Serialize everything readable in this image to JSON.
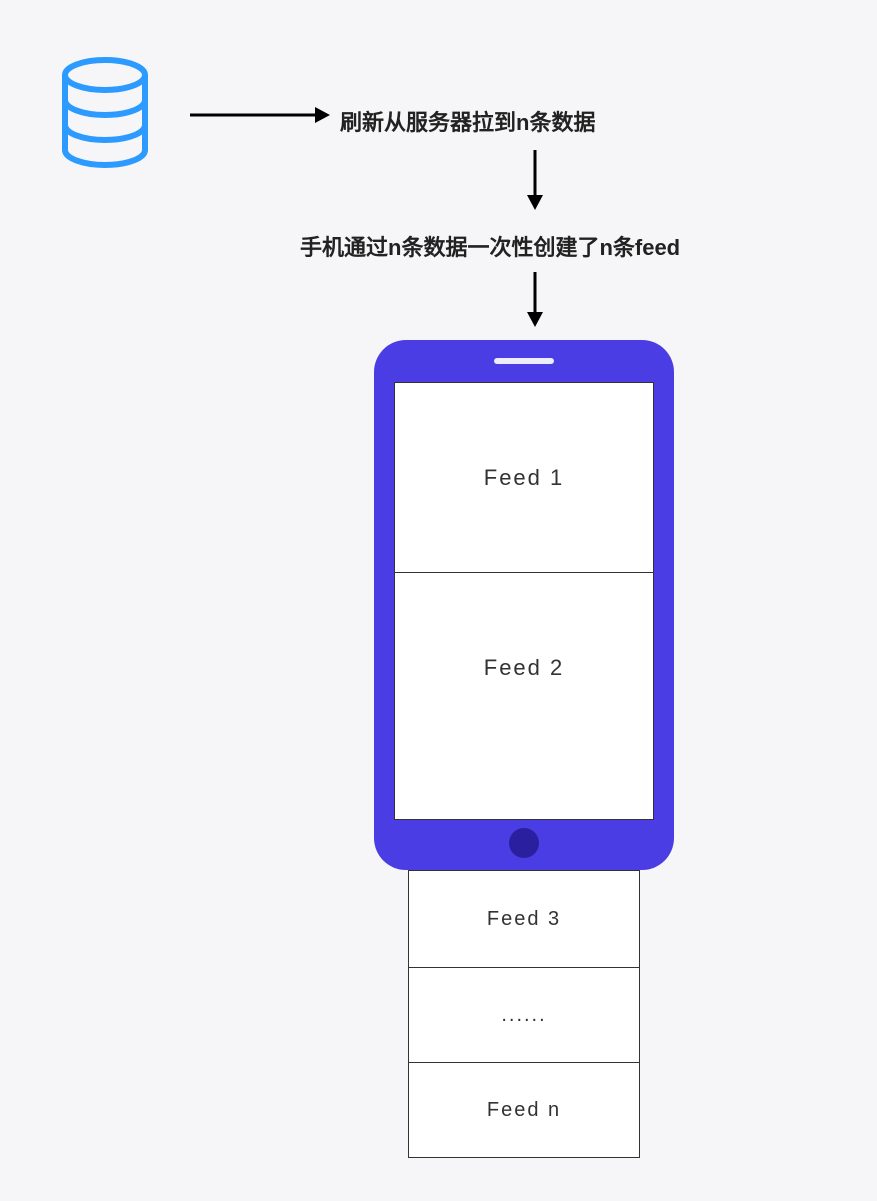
{
  "labels": {
    "step1": "刷新从服务器拉到n条数据",
    "step2": "手机通过n条数据一次性创建了n条feed"
  },
  "feeds": {
    "feed1": "Feed 1",
    "feed2": "Feed 2",
    "feed3": "Feed 3",
    "more": "......",
    "feedN": "Feed n"
  },
  "colors": {
    "database": "#2c9aff",
    "phone": "#4b3de4",
    "phoneDark": "#2a1f9e",
    "text": "#222",
    "border": "#333",
    "bg": "#f6f6f8"
  }
}
